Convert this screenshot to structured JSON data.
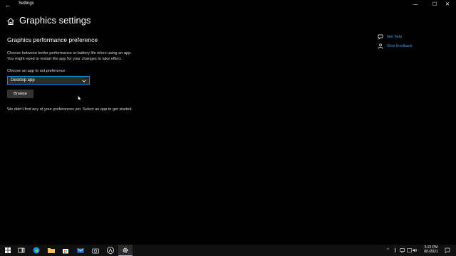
{
  "window": {
    "back_glyph": "←",
    "title": "Settings",
    "minimize_glyph": "—",
    "maximize_glyph": "☐",
    "close_glyph": "✕"
  },
  "page": {
    "title": "Graphics settings",
    "section_title": "Graphics performance preference",
    "description_line1": "Choose between better performance or battery life when using an app.",
    "description_line2": "You might need to restart the app for your changes to take effect.",
    "choose_label": "Choose an app to set preference",
    "dropdown_value": "Desktop app",
    "browse_label": "Browse",
    "empty_message": "We didn't find any of your preferences yet. Select an app to get started."
  },
  "help": {
    "get_help": "Get help",
    "give_feedback": "Give feedback"
  },
  "taskbar": {
    "icons": [
      "windows-start-icon",
      "task-view-icon",
      "edge-browser-icon",
      "file-explorer-icon",
      "store-icon",
      "mail-icon",
      "camera-icon",
      "app-icon",
      "settings-icon"
    ],
    "tray": [
      "chevron-up-icon",
      "pen-icon",
      "network-icon",
      "language-icon",
      "battery-icon",
      "volume-icon"
    ],
    "time": "5:22 PM",
    "date": "8/1/2021"
  },
  "colors": {
    "background": "#000000",
    "accent": "#0a84d8",
    "link": "#3c9ce0",
    "taskbar": "#101010"
  }
}
